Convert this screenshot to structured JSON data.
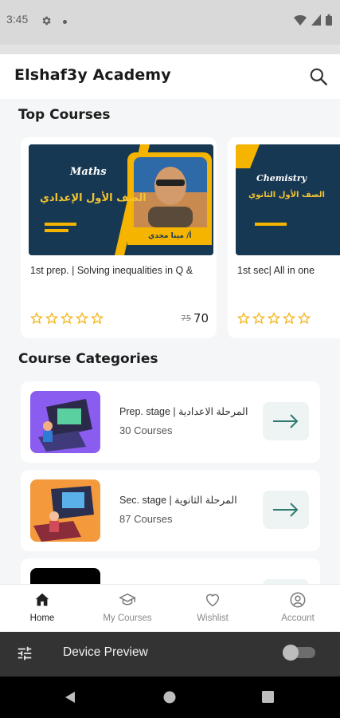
{
  "status_bar": {
    "time": "3:45"
  },
  "app": {
    "title": "Elshaf3y Academy"
  },
  "top_courses": {
    "title": "Top Courses",
    "items": [
      {
        "name": "1st prep. | Solving inequalities in Q &",
        "old_price": "75",
        "price": "70",
        "thumb_subject": "Maths",
        "thumb_arabic": "الصف الأول الإعدادي",
        "thumb_teacher": "أ/ مينا مجدي"
      },
      {
        "name": "1st sec| All in one",
        "thumb_subject": "Chemistry",
        "thumb_arabic": "الصف الأول الثانوي"
      }
    ]
  },
  "categories": {
    "title": "Course Categories",
    "items": [
      {
        "name": "Prep. stage | المرحلة الاعدادية",
        "count": "30 Courses"
      },
      {
        "name": "Sec. stage | المرحلة الثانوية",
        "count": "87 Courses"
      }
    ]
  },
  "bottom_nav": {
    "items": [
      "Home",
      "My Courses",
      "Wishlist",
      "Account"
    ],
    "active": "Home"
  },
  "device_preview": {
    "label": "Device Preview"
  },
  "colors": {
    "accent": "#2f7a6f",
    "thumb_navy": "#173853",
    "thumb_yellow": "#f4b400",
    "star": "#f2b51c"
  }
}
